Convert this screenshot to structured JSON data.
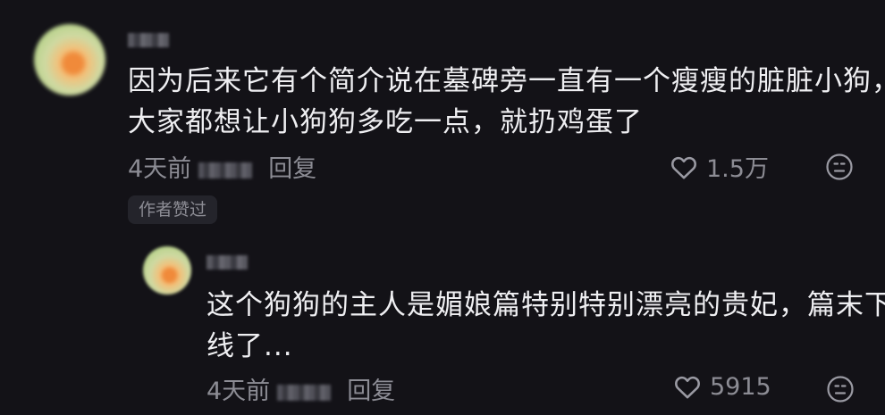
{
  "comments": [
    {
      "username": "",
      "avatar_icon": "user-avatar",
      "text_lines": [
        "因为后来它有个简介说在墓碑旁一直有一个瘦瘦的脏脏小狗，",
        "大家都想让小狗狗多吃一点，就扔鸡蛋了"
      ],
      "time": "4天前",
      "reply_label": "回复",
      "likes": "1.5万",
      "like_icon": "heart-outline",
      "dislike_icon": "dislike-face-outline",
      "badge": "作者赞过"
    },
    {
      "username": "",
      "avatar_icon": "user-avatar",
      "text_lines": [
        "这个狗狗的主人是媚娘篇特别特别漂亮的贵妃，篇末下",
        "线了..."
      ],
      "time": "4天前",
      "reply_label": "回复",
      "likes": "5915",
      "like_icon": "heart-outline",
      "dislike_icon": "dislike-face-outline"
    }
  ],
  "colors": {
    "background": "#131217",
    "primary_text": "#efeff2",
    "secondary_text": "#8c8c94",
    "badge_background": "#24242b"
  }
}
